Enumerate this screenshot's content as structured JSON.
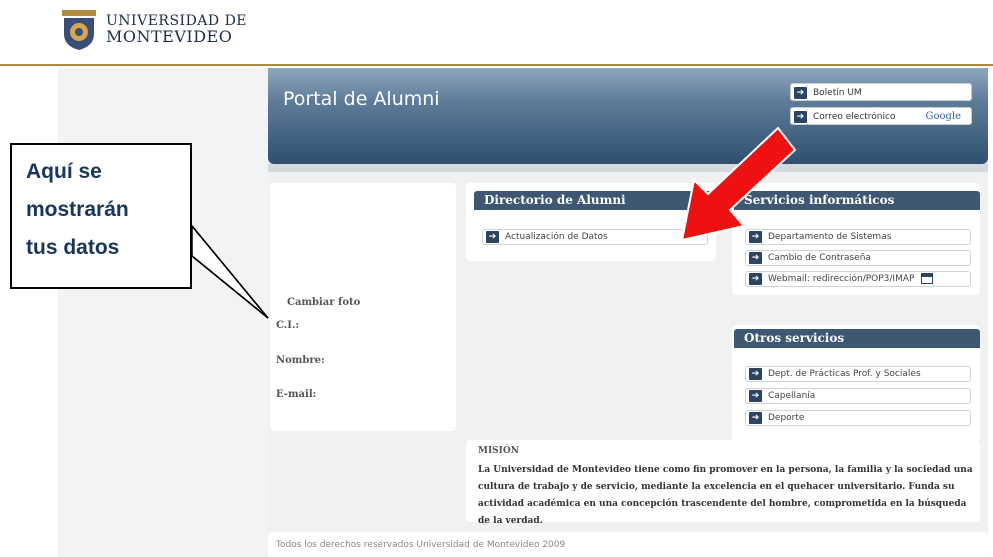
{
  "logo": {
    "line1": "UNIVERSIDAD DE",
    "line2": "MONTEVIDEO",
    "badge": "UM"
  },
  "header": {
    "title": "Portal de Alumni",
    "links": [
      {
        "label": "Boletín UM"
      },
      {
        "label": "Correo electrónico",
        "extra": "Google"
      }
    ]
  },
  "profile": {
    "change_photo": "Cambiar foto",
    "ci_label": "C.I.:",
    "name_label": "Nombre:",
    "email_label": "E-mail:"
  },
  "callout": {
    "line1": "Aquí se",
    "line2": "mostrarán",
    "line3": "tus datos"
  },
  "directorio": {
    "title": "Directorio de Alumni",
    "items": [
      {
        "label": "Actualización de Datos"
      }
    ]
  },
  "servicios": {
    "title": "Servicios informáticos",
    "items": [
      {
        "label": "Departamento de Sistemas"
      },
      {
        "label": "Cambio de Contraseña"
      },
      {
        "label": "Webmail: redirección/POP3/IMAP"
      }
    ]
  },
  "otros": {
    "title": "Otros servicios",
    "items": [
      {
        "label": "Dept. de Prácticas Prof. y Sociales"
      },
      {
        "label": "Capellanía"
      },
      {
        "label": "Deporte"
      }
    ]
  },
  "mision": {
    "title": "MISIÓN",
    "text": "La Universidad de Montevideo tiene como fin promover en la persona, la familia y la sociedad una cultura de trabajo y de servicio, mediante la excelencia en el quehacer universitario. Funda su actividad académica en una concepción trascendente del hombre, comprometida en la búsqueda de la verdad."
  },
  "footer": {
    "text": "Todos los derechos reservados Universidad de Montevideo 2009"
  },
  "colors": {
    "header": "#2f4f70",
    "section": "#3e5874",
    "arrow": "#ff0000",
    "callout_text": "#17365d"
  }
}
